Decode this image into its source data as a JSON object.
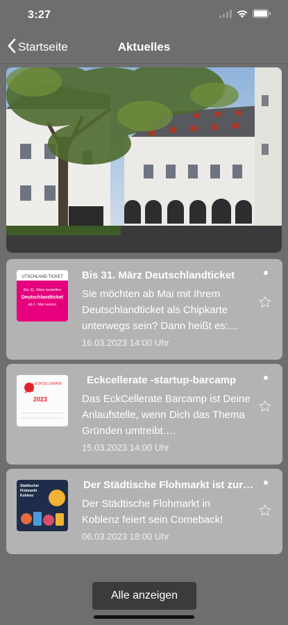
{
  "status_bar": {
    "time": "3:27"
  },
  "nav": {
    "back_label": "Startseite",
    "title": "Aktuelles"
  },
  "news": [
    {
      "title": "Bis 31. März Deutschlandticket",
      "text": "Sie möchten ab Mai mit Ihrem Deutschlandticket als Chipkarte unterwegs sein? Dann heißt es:…",
      "date": "16.03.2023 14:00 Uhr",
      "thumb": {
        "line1": "UTSCHLAND TICKET",
        "line2": "Bis 31. März bestellen",
        "line3": "Deutschlandticket",
        "line4": "ab 1. Mai nutzen"
      }
    },
    {
      "title": "Eckcellerate -startup-barcamp",
      "text": "Das EckCellerate Barcamp ist Deine Anlaufstelle, wenn Dich das Thema Gründen umtreibt.…",
      "date": "15.03.2023 14:00 Uhr",
      "thumb": {
        "line1": "ECKCELLERATE",
        "line2": "2023"
      }
    },
    {
      "title": "Der Städtische Flohmarkt ist zurück",
      "text": "Der Städtische Flohmarkt in Koblenz feiert sein Comeback!",
      "date": "06.03.2023 18:00 Uhr",
      "thumb": {
        "line1": "Städtischer",
        "line2": "Flohmarkt",
        "line3": "Koblenz"
      }
    }
  ],
  "show_all_label": "Alle anzeigen",
  "colors": {
    "background": "#6e6e6e",
    "card": "#b3b3b3",
    "button": "#3b3b3b",
    "thumb_pink": "#e6007e"
  }
}
